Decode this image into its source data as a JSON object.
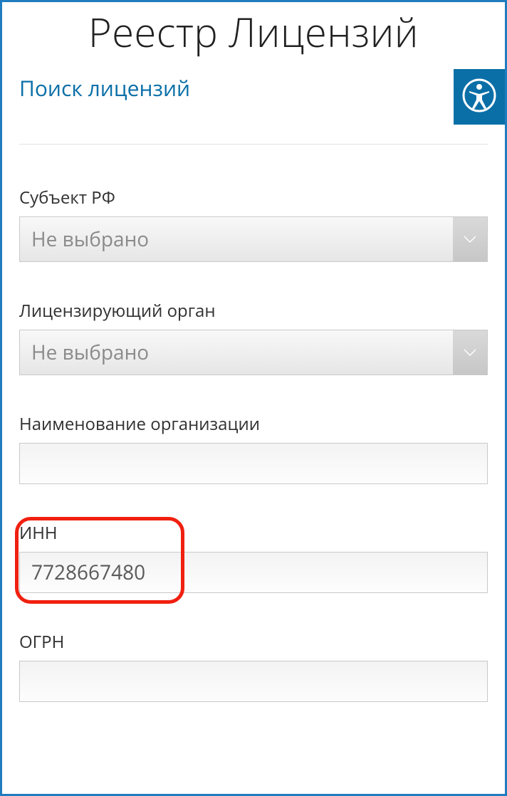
{
  "header": {
    "title": "Реестр Лицензий",
    "subtitle": "Поиск лицензий"
  },
  "form": {
    "subject": {
      "label": "Субъект РФ",
      "selected": "Не выбрано"
    },
    "authority": {
      "label": "Лицензирующий орган",
      "selected": "Не выбрано"
    },
    "orgName": {
      "label": "Наименование организации",
      "value": ""
    },
    "inn": {
      "label": "ИНН",
      "value": "7728667480"
    },
    "ogrn": {
      "label": "ОГРН",
      "value": ""
    }
  }
}
